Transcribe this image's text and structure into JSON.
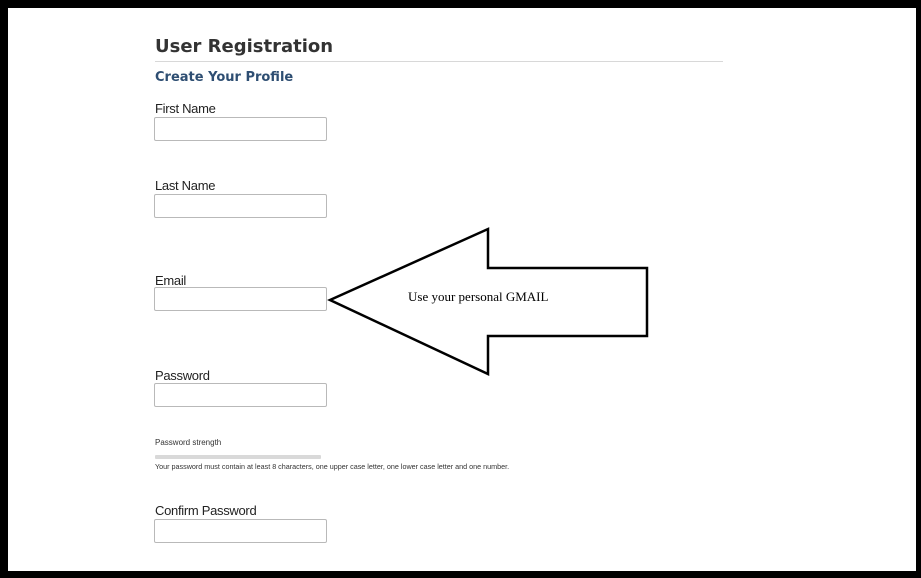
{
  "form": {
    "title": "User Registration",
    "subtitle": "Create Your Profile",
    "fields": [
      {
        "label": "First Name",
        "value": ""
      },
      {
        "label": "Last Name",
        "value": ""
      },
      {
        "label": "Email",
        "value": ""
      },
      {
        "label": "Password",
        "value": ""
      },
      {
        "label": "Confirm Password",
        "value": ""
      }
    ],
    "password_strength": {
      "label": "Password strength",
      "level": 0,
      "hint": "Your password must contain at least 8 characters, one upper case letter, one lower case letter and one number."
    }
  },
  "annotation": {
    "text": "Use your personal GMAIL"
  },
  "colors": {
    "frame": "#000000",
    "subtitle": "#2e4e72",
    "input_border": "#b9b9b9"
  }
}
